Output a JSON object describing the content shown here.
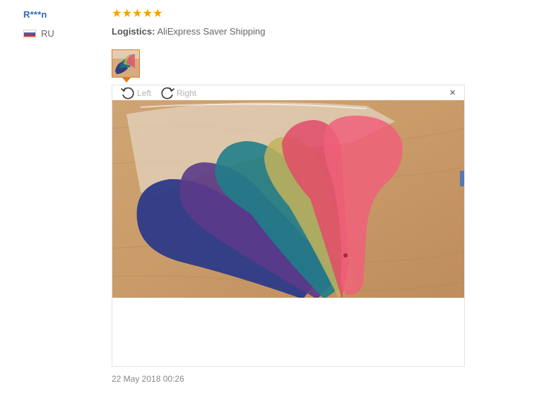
{
  "reviewer": {
    "name": "R***n",
    "country_code": "RU",
    "flag_icon": "russia-flag-icon"
  },
  "rating": {
    "stars": 5,
    "max": 5,
    "star_color": "#f7a000"
  },
  "logistics": {
    "label": "Logistics:",
    "value": "AliExpress Saver Shipping"
  },
  "attachments": {
    "thumbnail_icon": "photo-thumbnail",
    "selected_border_color": "#e37a1b"
  },
  "viewer": {
    "rotate_left_label": "Left",
    "rotate_right_label": "Right",
    "close_symbol": "×",
    "photo_description_icon": "review-photo"
  },
  "review_date": "22 May 2018 00:26",
  "colors": {
    "username": "#2d6db0",
    "muted_text": "#666666",
    "disabled_text": "#b5b5b5"
  }
}
